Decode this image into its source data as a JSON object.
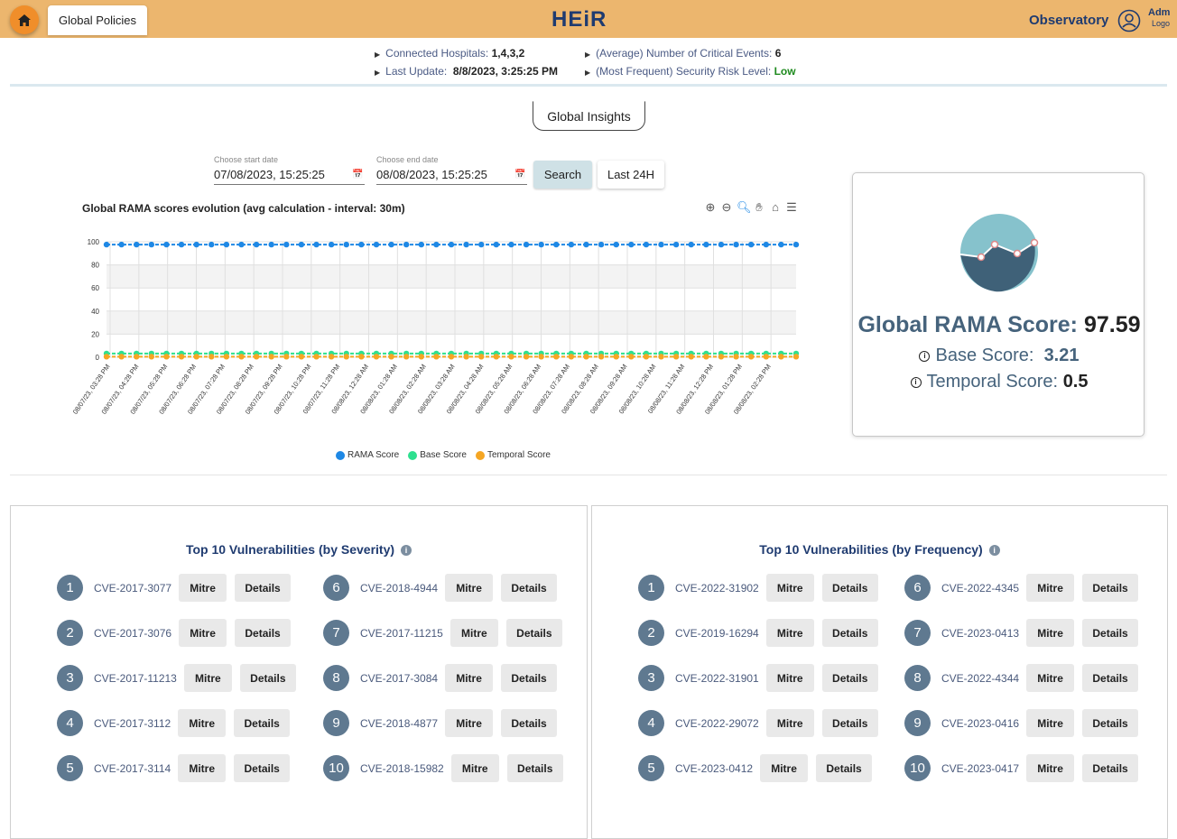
{
  "header": {
    "tab_label": "Global Policies",
    "brand": "HEiR",
    "observatory_label": "Observatory",
    "user_name": "Adm",
    "user_action": "Logo"
  },
  "info": {
    "hospitals_label": "Connected Hospitals:",
    "hospitals_value": "1,4,3,2",
    "update_label": "Last Update:",
    "update_value": "8/8/2023, 3:25:25 PM",
    "critical_label": "(Average) Number of Critical Events:",
    "critical_value": "6",
    "risk_label": "(Most Frequent) Security Risk Level:",
    "risk_value": "Low"
  },
  "insights_label": "Global Insights",
  "filters": {
    "start_label": "Choose start date",
    "start_value": "07/08/2023, 15:25:25",
    "end_label": "Choose end date",
    "end_value": "08/08/2023, 15:25:25",
    "search_label": "Search",
    "last24_label": "Last 24H"
  },
  "chart_data": {
    "type": "line",
    "title": "Global RAMA scores evolution (avg calculation - interval: 30m)",
    "ylim": [
      0,
      100
    ],
    "yticks": [
      0,
      20,
      40,
      60,
      80,
      100
    ],
    "grid": true,
    "legend_position": "bottom",
    "x_tick_labels": [
      "08/07/23, 03:28 PM",
      "08/07/23, 04:28 PM",
      "08/07/23, 05:28 PM",
      "08/07/23, 06:28 PM",
      "08/07/23, 07:28 PM",
      "08/07/23, 08:28 PM",
      "08/07/23, 09:28 PM",
      "08/07/23, 10:28 PM",
      "08/07/23, 11:28 PM",
      "08/08/23, 12:28 AM",
      "08/08/23, 01:28 AM",
      "08/08/23, 02:28 AM",
      "08/08/23, 03:28 AM",
      "08/08/23, 04:28 AM",
      "08/08/23, 05:28 AM",
      "08/08/23, 06:28 AM",
      "08/08/23, 07:28 AM",
      "08/08/23, 08:28 AM",
      "08/08/23, 09:28 AM",
      "08/08/23, 10:28 AM",
      "08/08/23, 11:28 AM",
      "08/08/23, 12:28 PM",
      "08/08/23, 01:28 PM",
      "08/08/23, 02:28 PM"
    ],
    "points_per_series": 47,
    "series": [
      {
        "name": "RAMA Score",
        "color": "#1e88e5",
        "value": 97.59
      },
      {
        "name": "Base Score",
        "color": "#2ee08f",
        "value": 3.21
      },
      {
        "name": "Temporal Score",
        "color": "#f5a623",
        "value": 0.5
      }
    ]
  },
  "toolbar_icons": [
    "zoom-in-icon",
    "zoom-out-icon",
    "magnifier-icon",
    "pan-hand-icon",
    "home-icon",
    "menu-icon"
  ],
  "score_card": {
    "main_label": "Global RAMA Score:",
    "main_value": "97.59",
    "base_label": "Base Score:",
    "base_value": "3.21",
    "temporal_label": "Temporal Score:",
    "temporal_value": "0.5"
  },
  "severity": {
    "title": "Top 10 Vulnerabilities (by Severity)",
    "mitre_label": "Mitre",
    "details_label": "Details",
    "items": [
      {
        "n": "1",
        "cve": "CVE-2017-3077"
      },
      {
        "n": "2",
        "cve": "CVE-2017-3076"
      },
      {
        "n": "3",
        "cve": "CVE-2017-11213"
      },
      {
        "n": "4",
        "cve": "CVE-2017-3112"
      },
      {
        "n": "5",
        "cve": "CVE-2017-3114"
      },
      {
        "n": "6",
        "cve": "CVE-2018-4944"
      },
      {
        "n": "7",
        "cve": "CVE-2017-11215"
      },
      {
        "n": "8",
        "cve": "CVE-2017-3084"
      },
      {
        "n": "9",
        "cve": "CVE-2018-4877"
      },
      {
        "n": "10",
        "cve": "CVE-2018-15982"
      }
    ]
  },
  "frequency": {
    "title": "Top 10 Vulnerabilities (by Frequency)",
    "mitre_label": "Mitre",
    "details_label": "Details",
    "items": [
      {
        "n": "1",
        "cve": "CVE-2022-31902"
      },
      {
        "n": "2",
        "cve": "CVE-2019-16294"
      },
      {
        "n": "3",
        "cve": "CVE-2022-31901"
      },
      {
        "n": "4",
        "cve": "CVE-2022-29072"
      },
      {
        "n": "5",
        "cve": "CVE-2023-0412"
      },
      {
        "n": "6",
        "cve": "CVE-2022-4345"
      },
      {
        "n": "7",
        "cve": "CVE-2023-0413"
      },
      {
        "n": "8",
        "cve": "CVE-2022-4344"
      },
      {
        "n": "9",
        "cve": "CVE-2023-0416"
      },
      {
        "n": "10",
        "cve": "CVE-2023-0417"
      }
    ]
  }
}
